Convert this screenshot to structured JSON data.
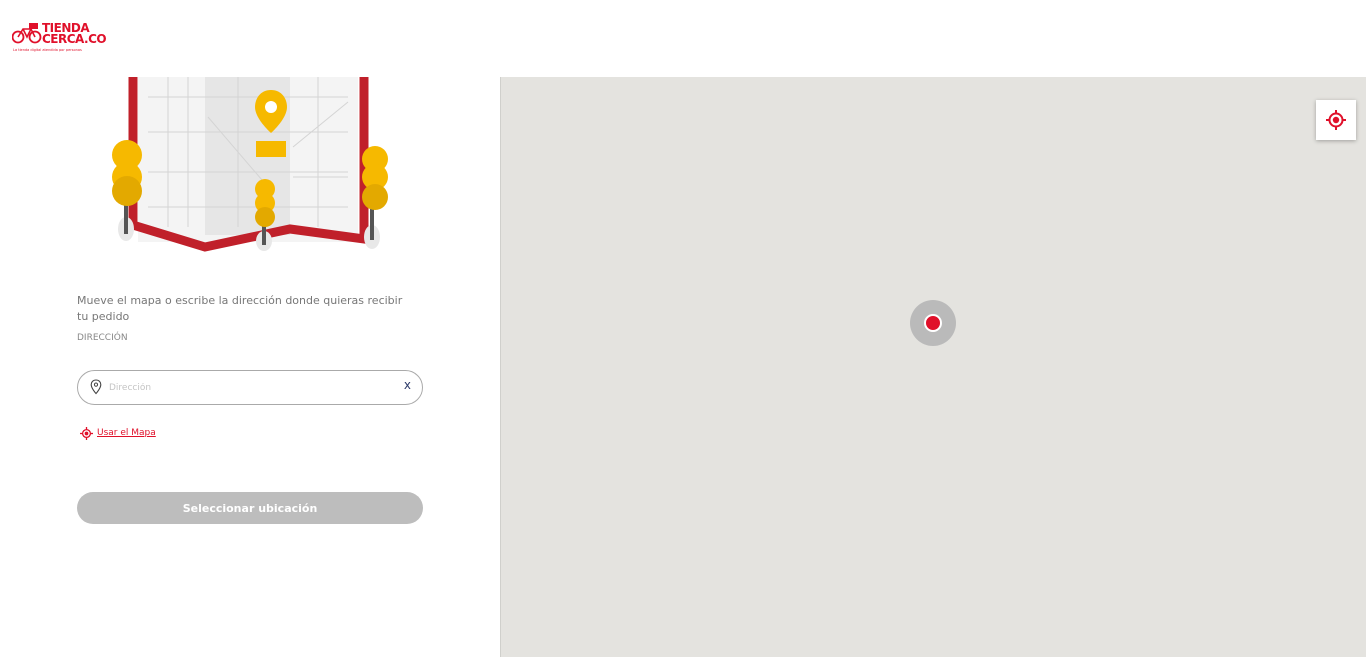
{
  "brand": {
    "name_line1": "TIENDA",
    "name_line2": "CERCA.CO",
    "tagline": "La tienda digital atendida por personas",
    "color": "#e0102a"
  },
  "left_panel": {
    "instruction": "Mueve el mapa o escribe la dirección donde quieras recibir tu pedido",
    "field_label": "DIRECCIÓN",
    "address": {
      "value": "",
      "placeholder": "Dirección",
      "clear_label": "x",
      "icon": "map-pin-icon"
    },
    "use_map_label": "Usar el Mapa",
    "use_map_icon": "crosshair-icon",
    "select_button_label": "Seleccionar ubicación"
  },
  "map": {
    "locate_icon": "crosshair-icon",
    "marker_color": "#e0102a",
    "background": "#e4e3df"
  }
}
